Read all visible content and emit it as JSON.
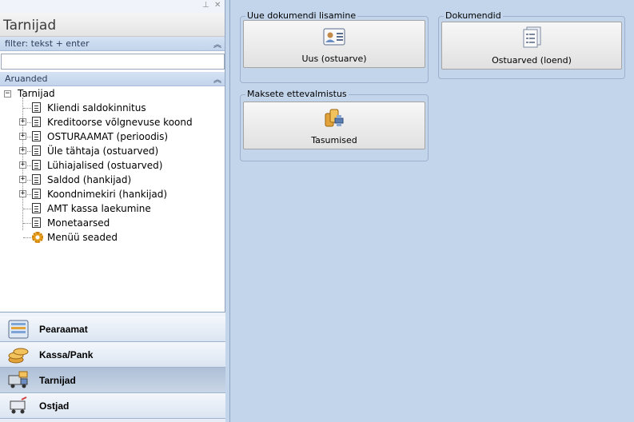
{
  "window": {
    "pin_glyph": "⊥",
    "close_glyph": "✕"
  },
  "left": {
    "title": "Tarnijad",
    "filter_label": "filter: tekst + enter",
    "filter_value": "",
    "reports_label": "Aruanded",
    "tree_root": "Tarnijad",
    "tree_items": [
      {
        "label": "Kliendi saldokinnitus",
        "expandable": false,
        "icon": "document-icon"
      },
      {
        "label": "Kreditoorse võlgnevuse koond",
        "expandable": true,
        "icon": "document-icon"
      },
      {
        "label": "OSTURAAMAT (perioodis)",
        "expandable": true,
        "icon": "document-icon"
      },
      {
        "label": "Üle tähtaja (ostuarved)",
        "expandable": true,
        "icon": "document-icon"
      },
      {
        "label": "Lühiajalised (ostuarved)",
        "expandable": true,
        "icon": "document-icon"
      },
      {
        "label": "Saldod (hankijad)",
        "expandable": true,
        "icon": "document-icon"
      },
      {
        "label": "Koondnimekiri (hankijad)",
        "expandable": true,
        "icon": "document-icon"
      },
      {
        "label": "AMT kassa laekumine",
        "expandable": false,
        "icon": "document-icon"
      },
      {
        "label": "Monetaarsed",
        "expandable": false,
        "icon": "document-icon"
      },
      {
        "label": "Menüü seaded",
        "expandable": false,
        "icon": "gear-icon"
      }
    ],
    "nav": [
      {
        "label": "Pearaamat",
        "icon": "ledger-icon",
        "active": false
      },
      {
        "label": "Kassa/Pank",
        "icon": "coins-icon",
        "active": false
      },
      {
        "label": "Tarnijad",
        "icon": "truck-icon",
        "active": true
      },
      {
        "label": "Ostjad",
        "icon": "cart-icon",
        "active": false
      }
    ]
  },
  "right": {
    "groups": [
      {
        "title": "Uue dokumendi lisamine",
        "tile_label": "Uus (ostuarve)",
        "icon": "contact-card-icon"
      },
      {
        "title": "Dokumendid",
        "tile_label": "Ostuarved (loend)",
        "icon": "document-list-icon"
      },
      {
        "title": "Maksete ettevalmistus",
        "tile_label": "Tasumised",
        "icon": "payment-icon"
      }
    ]
  }
}
